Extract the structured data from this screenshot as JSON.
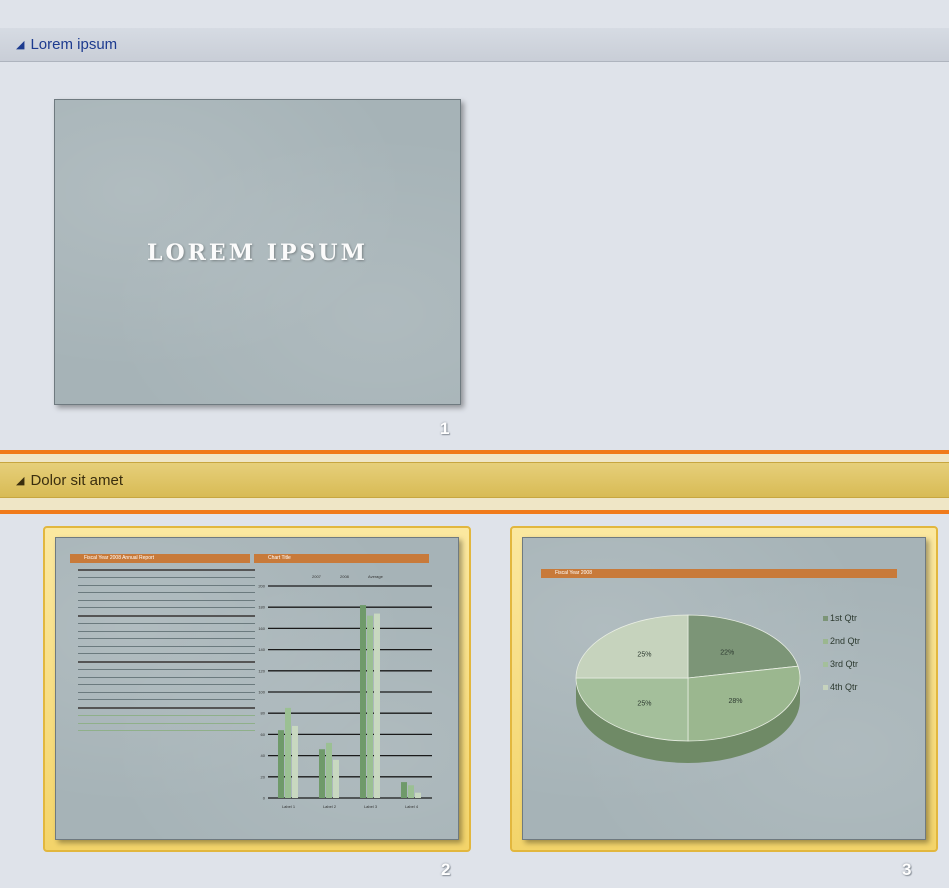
{
  "sections": [
    {
      "title": "Lorem ipsum",
      "collapse_glyph": "◢"
    },
    {
      "title": "Dolor sit amet",
      "collapse_glyph": "◢"
    }
  ],
  "slides": [
    {
      "number": "1",
      "title": "LOREM IPSUM"
    },
    {
      "number": "2",
      "table_heading": "Fiscal Year 2008 Annual Report",
      "chart_heading": "Chart Title",
      "chart_legend": [
        "2007",
        "2008",
        "Average"
      ],
      "chart_categories": [
        "Label 1",
        "Label 2",
        "Label 3",
        "Label 4"
      ]
    },
    {
      "number": "3",
      "banner": "Fiscal Year 2008",
      "chart_data": {
        "type": "pie",
        "categories": [
          "1st Qtr",
          "2nd Qtr",
          "3rd Qtr",
          "4th Qtr"
        ],
        "values": [
          22,
          28,
          25,
          25
        ],
        "data_labels": [
          "22%",
          "28%",
          "25%",
          "25%"
        ],
        "colors": [
          "#7c9577",
          "#9bb78f",
          "#a4bf9b",
          "#c6d3bd"
        ]
      }
    }
  ],
  "slide2_chart": {
    "chart_data": {
      "type": "bar",
      "categories": [
        "Label 1",
        "Label 2",
        "Label 3",
        "Label 4"
      ],
      "series": [
        {
          "name": "2007",
          "values": [
            64,
            46,
            182,
            15
          ]
        },
        {
          "name": "2008",
          "values": [
            85,
            52,
            172,
            12
          ]
        },
        {
          "name": "Average",
          "values": [
            68,
            36,
            174,
            5
          ]
        }
      ],
      "ylim": [
        0,
        200
      ],
      "yticks": [
        "0",
        "20",
        "40",
        "60",
        "80",
        "100",
        "120",
        "140",
        "160",
        "180",
        "200"
      ],
      "colors": [
        "#6f9a6a",
        "#9bc093",
        "#c8d8c0"
      ]
    }
  }
}
